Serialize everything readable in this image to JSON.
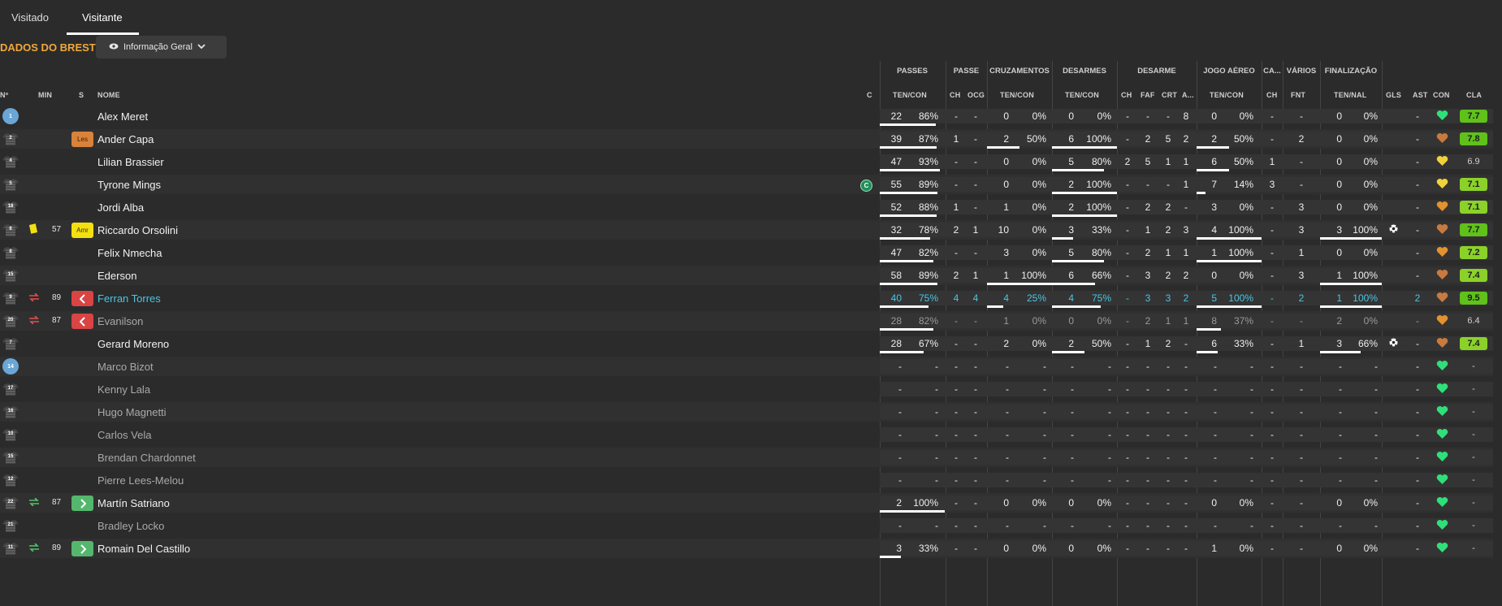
{
  "tabs": [
    {
      "label": "Visitado"
    },
    {
      "label": "Visitante"
    }
  ],
  "section_title": "DADOS DO BREST",
  "view_select": {
    "label": "Informação Geral"
  },
  "headers": {
    "groups": [
      "PASSES",
      "PASSE",
      "CRUZAMENTOS",
      "DESARMES",
      "DESARME",
      "JOGO AÉREO",
      "CA...",
      "VÁRIOS",
      "FINALIZAÇÃO"
    ],
    "sub": {
      "no": "Nº",
      "min": "MIN",
      "s": "S",
      "nome": "NOME",
      "c": "C",
      "passes": "TEN/CON",
      "ch": "CH",
      "ocg": "OCG",
      "cruz": "TEN/CON",
      "des": "TEN/CON",
      "d_ch": "CH",
      "d_faf": "FAF",
      "d_crt": "CRT",
      "d_a": "A...",
      "aereo": "TEN/CON",
      "ca_ch": "CH",
      "fnt": "FNT",
      "fin": "TEN/NAL",
      "gls": "GLS",
      "ast": "AST",
      "con": "CON",
      "cla": "CLA"
    }
  },
  "rows": [
    {
      "no": "1",
      "name": "Alex Meret",
      "badge": "",
      "min": "",
      "event": "",
      "p": [
        "22",
        "86%"
      ],
      "pf": 0.86,
      "ch": "-",
      "ocg": "-",
      "cz": [
        "0",
        "0%"
      ],
      "czf": 0,
      "ds": [
        "0",
        "0%"
      ],
      "dsf": 0,
      "dch": "-",
      "faf": "-",
      "crt": "-",
      "da": "8",
      "ae": [
        "0",
        "0%"
      ],
      "aef": 0,
      "cach": "-",
      "fnt": "-",
      "fi": [
        "0",
        "0%"
      ],
      "fif": 0,
      "gls": "",
      "ast": "-",
      "con": "green",
      "cla": "7.7"
    },
    {
      "no": "2",
      "name": "Ander Capa",
      "badge": "Les",
      "min": "",
      "event": "",
      "p": [
        "39",
        "87%"
      ],
      "pf": 0.87,
      "ch": "1",
      "ocg": "-",
      "cz": [
        "2",
        "50%"
      ],
      "czf": 0.5,
      "ds": [
        "6",
        "100%"
      ],
      "dsf": 1,
      "dch": "-",
      "faf": "2",
      "crt": "5",
      "da": "2",
      "ae": [
        "2",
        "50%"
      ],
      "aef": 0.5,
      "cach": "-",
      "fnt": "2",
      "fi": [
        "0",
        "0%"
      ],
      "fif": 0,
      "gls": "",
      "ast": "-",
      "con": "brown",
      "cla": "7.8"
    },
    {
      "no": "4",
      "name": "Lilian Brassier",
      "badge": "",
      "min": "",
      "event": "",
      "p": [
        "47",
        "93%"
      ],
      "pf": 0.93,
      "ch": "-",
      "ocg": "-",
      "cz": [
        "0",
        "0%"
      ],
      "czf": 0,
      "ds": [
        "5",
        "80%"
      ],
      "dsf": 0.8,
      "dch": "2",
      "faf": "5",
      "crt": "1",
      "da": "1",
      "ae": [
        "6",
        "50%"
      ],
      "aef": 0.5,
      "cach": "1",
      "fnt": "-",
      "fi": [
        "0",
        "0%"
      ],
      "fif": 0,
      "gls": "",
      "ast": "-",
      "con": "yellow",
      "cla": "6.9"
    },
    {
      "no": "5",
      "name": "Tyrone Mings",
      "badge": "",
      "min": "",
      "event": "",
      "captain": "C",
      "p": [
        "55",
        "89%"
      ],
      "pf": 0.89,
      "ch": "-",
      "ocg": "-",
      "cz": [
        "0",
        "0%"
      ],
      "czf": 0,
      "ds": [
        "2",
        "100%"
      ],
      "dsf": 1,
      "dch": "-",
      "faf": "-",
      "crt": "-",
      "da": "1",
      "ae": [
        "7",
        "14%"
      ],
      "aef": 0.14,
      "cach": "3",
      "fnt": "-",
      "fi": [
        "0",
        "0%"
      ],
      "fif": 0,
      "gls": "",
      "ast": "-",
      "con": "yellow",
      "cla": "7.1"
    },
    {
      "no": "18",
      "name": "Jordi Alba",
      "badge": "",
      "min": "",
      "event": "",
      "p": [
        "52",
        "88%"
      ],
      "pf": 0.88,
      "ch": "1",
      "ocg": "-",
      "cz": [
        "1",
        "0%"
      ],
      "czf": 0,
      "ds": [
        "2",
        "100%"
      ],
      "dsf": 1,
      "dch": "-",
      "faf": "2",
      "crt": "2",
      "da": "-",
      "ae": [
        "3",
        "0%"
      ],
      "aef": 0,
      "cach": "-",
      "fnt": "3",
      "fi": [
        "0",
        "0%"
      ],
      "fif": 0,
      "gls": "",
      "ast": "-",
      "con": "orange",
      "cla": "7.1"
    },
    {
      "no": "6",
      "name": "Riccardo Orsolini",
      "badge": "Amr",
      "min": "57",
      "event": "card",
      "p": [
        "32",
        "78%"
      ],
      "pf": 0.78,
      "ch": "2",
      "ocg": "1",
      "cz": [
        "10",
        "0%"
      ],
      "czf": 0,
      "ds": [
        "3",
        "33%"
      ],
      "dsf": 0.33,
      "dch": "-",
      "faf": "1",
      "crt": "2",
      "da": "3",
      "ae": [
        "4",
        "100%"
      ],
      "aef": 1,
      "cach": "-",
      "fnt": "3",
      "fi": [
        "3",
        "100%"
      ],
      "fif": 1,
      "gls": "ball",
      "ast": "-",
      "con": "brown",
      "cla": "7.7"
    },
    {
      "no": "8",
      "name": "Felix Nmecha",
      "badge": "",
      "min": "",
      "event": "",
      "p": [
        "47",
        "82%"
      ],
      "pf": 0.82,
      "ch": "-",
      "ocg": "-",
      "cz": [
        "3",
        "0%"
      ],
      "czf": 0,
      "ds": [
        "5",
        "80%"
      ],
      "dsf": 0.8,
      "dch": "-",
      "faf": "2",
      "crt": "1",
      "da": "1",
      "ae": [
        "1",
        "100%"
      ],
      "aef": 1,
      "cach": "-",
      "fnt": "1",
      "fi": [
        "0",
        "0%"
      ],
      "fif": 0,
      "gls": "",
      "ast": "-",
      "con": "orange",
      "cla": "7.2"
    },
    {
      "no": "15",
      "name": "Ederson",
      "badge": "",
      "min": "",
      "event": "",
      "p": [
        "58",
        "89%"
      ],
      "pf": 0.89,
      "ch": "2",
      "ocg": "1",
      "cz": [
        "1",
        "100%"
      ],
      "czf": 1,
      "ds": [
        "6",
        "66%"
      ],
      "dsf": 0.66,
      "dch": "-",
      "faf": "3",
      "crt": "2",
      "da": "2",
      "ae": [
        "0",
        "0%"
      ],
      "aef": 0,
      "cach": "-",
      "fnt": "3",
      "fi": [
        "1",
        "100%"
      ],
      "fif": 1,
      "gls": "",
      "ast": "-",
      "con": "brown",
      "cla": "7.4"
    },
    {
      "no": "9",
      "name": "Ferran Torres",
      "badge": "out",
      "min": "89",
      "event": "sub-out",
      "hl": true,
      "p": [
        "40",
        "75%"
      ],
      "pf": 0.75,
      "ch": "4",
      "ocg": "4",
      "cz": [
        "4",
        "25%"
      ],
      "czf": 0.25,
      "ds": [
        "4",
        "75%"
      ],
      "dsf": 0.75,
      "dch": "-",
      "faf": "3",
      "crt": "3",
      "da": "2",
      "ae": [
        "5",
        "100%"
      ],
      "aef": 1,
      "cach": "-",
      "fnt": "2",
      "fi": [
        "1",
        "100%"
      ],
      "fif": 1,
      "gls": "",
      "ast": "2",
      "con": "brown",
      "cla": "9.5"
    },
    {
      "no": "20",
      "name": "Evanilson",
      "badge": "out",
      "min": "87",
      "event": "sub-out",
      "dim": true,
      "p": [
        "28",
        "82%"
      ],
      "pf": 0.82,
      "ch": "-",
      "ocg": "-",
      "cz": [
        "1",
        "0%"
      ],
      "czf": 0,
      "ds": [
        "0",
        "0%"
      ],
      "dsf": 0,
      "dch": "-",
      "faf": "2",
      "crt": "1",
      "da": "1",
      "ae": [
        "8",
        "37%"
      ],
      "aef": 0.37,
      "cach": "-",
      "fnt": "-",
      "fi": [
        "2",
        "0%"
      ],
      "fif": 0,
      "gls": "",
      "ast": "-",
      "con": "orange",
      "cla": "6.4"
    },
    {
      "no": "7",
      "name": "Gerard Moreno",
      "badge": "",
      "min": "",
      "event": "",
      "p": [
        "28",
        "67%"
      ],
      "pf": 0.67,
      "ch": "-",
      "ocg": "-",
      "cz": [
        "2",
        "0%"
      ],
      "czf": 0,
      "ds": [
        "2",
        "50%"
      ],
      "dsf": 0.5,
      "dch": "-",
      "faf": "1",
      "crt": "2",
      "da": "-",
      "ae": [
        "6",
        "33%"
      ],
      "aef": 0.33,
      "cach": "-",
      "fnt": "1",
      "fi": [
        "3",
        "66%"
      ],
      "fif": 0.66,
      "gls": "ball",
      "ast": "-",
      "con": "brown",
      "cla": "7.4"
    },
    {
      "no": "14",
      "name": "Marco Bizot",
      "sub": true,
      "gk": true,
      "p": [
        "-",
        "-"
      ],
      "pf": 0,
      "ch": "-",
      "ocg": "-",
      "cz": [
        "-",
        "-"
      ],
      "czf": 0,
      "ds": [
        "-",
        "-"
      ],
      "dsf": 0,
      "dch": "-",
      "faf": "-",
      "crt": "-",
      "da": "-",
      "ae": [
        "-",
        "-"
      ],
      "aef": 0,
      "cach": "-",
      "fnt": "-",
      "fi": [
        "-",
        "-"
      ],
      "fif": 0,
      "gls": "",
      "ast": "-",
      "con": "green",
      "cla": "-"
    },
    {
      "no": "17",
      "name": "Kenny Lala",
      "sub": true,
      "p": [
        "-",
        "-"
      ],
      "pf": 0,
      "ch": "-",
      "ocg": "-",
      "cz": [
        "-",
        "-"
      ],
      "czf": 0,
      "ds": [
        "-",
        "-"
      ],
      "dsf": 0,
      "dch": "-",
      "faf": "-",
      "crt": "-",
      "da": "-",
      "ae": [
        "-",
        "-"
      ],
      "aef": 0,
      "cach": "-",
      "fnt": "-",
      "fi": [
        "-",
        "-"
      ],
      "fif": 0,
      "gls": "",
      "ast": "-",
      "con": "green",
      "cla": "-"
    },
    {
      "no": "16",
      "name": "Hugo Magnetti",
      "sub": true,
      "p": [
        "-",
        "-"
      ],
      "pf": 0,
      "ch": "-",
      "ocg": "-",
      "cz": [
        "-",
        "-"
      ],
      "czf": 0,
      "ds": [
        "-",
        "-"
      ],
      "dsf": 0,
      "dch": "-",
      "faf": "-",
      "crt": "-",
      "da": "-",
      "ae": [
        "-",
        "-"
      ],
      "aef": 0,
      "cach": "-",
      "fnt": "-",
      "fi": [
        "-",
        "-"
      ],
      "fif": 0,
      "gls": "",
      "ast": "-",
      "con": "green",
      "cla": "-"
    },
    {
      "no": "10",
      "name": "Carlos Vela",
      "sub": true,
      "p": [
        "-",
        "-"
      ],
      "pf": 0,
      "ch": "-",
      "ocg": "-",
      "cz": [
        "-",
        "-"
      ],
      "czf": 0,
      "ds": [
        "-",
        "-"
      ],
      "dsf": 0,
      "dch": "-",
      "faf": "-",
      "crt": "-",
      "da": "-",
      "ae": [
        "-",
        "-"
      ],
      "aef": 0,
      "cach": "-",
      "fnt": "-",
      "fi": [
        "-",
        "-"
      ],
      "fif": 0,
      "gls": "",
      "ast": "-",
      "con": "green",
      "cla": "-"
    },
    {
      "no": "15",
      "name": "Brendan Chardonnet",
      "sub": true,
      "p": [
        "-",
        "-"
      ],
      "pf": 0,
      "ch": "-",
      "ocg": "-",
      "cz": [
        "-",
        "-"
      ],
      "czf": 0,
      "ds": [
        "-",
        "-"
      ],
      "dsf": 0,
      "dch": "-",
      "faf": "-",
      "crt": "-",
      "da": "-",
      "ae": [
        "-",
        "-"
      ],
      "aef": 0,
      "cach": "-",
      "fnt": "-",
      "fi": [
        "-",
        "-"
      ],
      "fif": 0,
      "gls": "",
      "ast": "-",
      "con": "green",
      "cla": "-"
    },
    {
      "no": "12",
      "name": "Pierre Lees-Melou",
      "sub": true,
      "p": [
        "-",
        "-"
      ],
      "pf": 0,
      "ch": "-",
      "ocg": "-",
      "cz": [
        "-",
        "-"
      ],
      "czf": 0,
      "ds": [
        "-",
        "-"
      ],
      "dsf": 0,
      "dch": "-",
      "faf": "-",
      "crt": "-",
      "da": "-",
      "ae": [
        "-",
        "-"
      ],
      "aef": 0,
      "cach": "-",
      "fnt": "-",
      "fi": [
        "-",
        "-"
      ],
      "fif": 0,
      "gls": "",
      "ast": "-",
      "con": "green",
      "cla": "-"
    },
    {
      "no": "22",
      "name": "Martín Satriano",
      "badge": "in",
      "min": "87",
      "event": "sub-in",
      "p": [
        "2",
        "100%"
      ],
      "pf": 1,
      "ch": "-",
      "ocg": "-",
      "cz": [
        "0",
        "0%"
      ],
      "czf": 0,
      "ds": [
        "0",
        "0%"
      ],
      "dsf": 0,
      "dch": "-",
      "faf": "-",
      "crt": "-",
      "da": "-",
      "ae": [
        "0",
        "0%"
      ],
      "aef": 0,
      "cach": "-",
      "fnt": "-",
      "fi": [
        "0",
        "0%"
      ],
      "fif": 0,
      "gls": "",
      "ast": "-",
      "con": "green",
      "cla": "-"
    },
    {
      "no": "21",
      "name": "Bradley Locko",
      "sub": true,
      "p": [
        "-",
        "-"
      ],
      "pf": 0,
      "ch": "-",
      "ocg": "-",
      "cz": [
        "-",
        "-"
      ],
      "czf": 0,
      "ds": [
        "-",
        "-"
      ],
      "dsf": 0,
      "dch": "-",
      "faf": "-",
      "crt": "-",
      "da": "-",
      "ae": [
        "-",
        "-"
      ],
      "aef": 0,
      "cach": "-",
      "fnt": "-",
      "fi": [
        "-",
        "-"
      ],
      "fif": 0,
      "gls": "",
      "ast": "-",
      "con": "green",
      "cla": "-"
    },
    {
      "no": "11",
      "name": "Romain Del Castillo",
      "badge": "in",
      "min": "89",
      "event": "sub-in",
      "p": [
        "3",
        "33%"
      ],
      "pf": 0.33,
      "ch": "-",
      "ocg": "-",
      "cz": [
        "0",
        "0%"
      ],
      "czf": 0,
      "ds": [
        "0",
        "0%"
      ],
      "dsf": 0,
      "dch": "-",
      "faf": "-",
      "crt": "-",
      "da": "-",
      "ae": [
        "1",
        "0%"
      ],
      "aef": 0,
      "cach": "-",
      "fnt": "-",
      "fi": [
        "0",
        "0%"
      ],
      "fif": 0,
      "gls": "",
      "ast": "-",
      "con": "green",
      "cla": "-"
    }
  ],
  "badge_labels": {
    "Les": "Les",
    "Amr": "Amr"
  },
  "colors": {
    "accent": "#f0a83a",
    "cyan": "#48c6e6",
    "heart_green": "#2fe07a",
    "heart_brown": "#c87a3f",
    "heart_orange": "#e2922e",
    "heart_yellow": "#f0d23a",
    "rating_high": "#5fc11a",
    "rating_mid": "#8bd12a"
  }
}
